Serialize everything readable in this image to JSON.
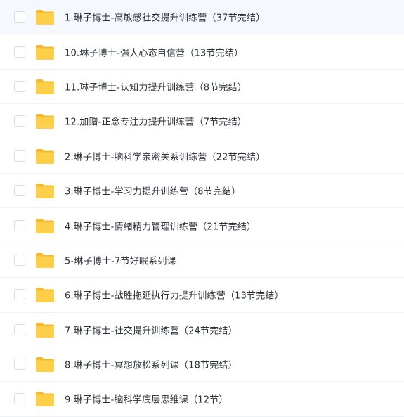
{
  "files": [
    {
      "name": "1.琳子博士-高敏感社交提升训练营（37节完结）",
      "icon": "folder-icon"
    },
    {
      "name": "10.琳子博士-强大心态自信营（13节完结）",
      "icon": "folder-icon"
    },
    {
      "name": "11.琳子博士-认知力提升训练营（8节完结）",
      "icon": "folder-icon"
    },
    {
      "name": "12.加赠-正念专注力提升训练营（7节完结）",
      "icon": "folder-icon"
    },
    {
      "name": "2.琳子博士-脑科学亲密关系训练营（22节完结）",
      "icon": "folder-icon"
    },
    {
      "name": "3.琳子博士-学习力提升训练营（8节完结）",
      "icon": "folder-icon"
    },
    {
      "name": "4.琳子博士-情绪精力管理训练营（21节完结）",
      "icon": "folder-icon"
    },
    {
      "name": "5-琳子博士-7节好眠系列课",
      "icon": "folder-icon"
    },
    {
      "name": "6.琳子博士-战胜拖延执行力提升训练营（13节完结）",
      "icon": "folder-icon"
    },
    {
      "name": "7.琳子博士-社交提升训练营（24节完结）",
      "icon": "folder-icon"
    },
    {
      "name": "8.琳子博士-冥想放松系列课（18节完结）",
      "icon": "folder-icon"
    },
    {
      "name": "9.琳子博士-脑科学底层思维课（12节）",
      "icon": "folder-icon"
    }
  ],
  "colors": {
    "folder_body": "#ffcf4a",
    "folder_tab": "#f5b92e",
    "text": "#2b2f36",
    "checkbox_border": "#d9dbe0",
    "divider": "#f1f2f4"
  }
}
